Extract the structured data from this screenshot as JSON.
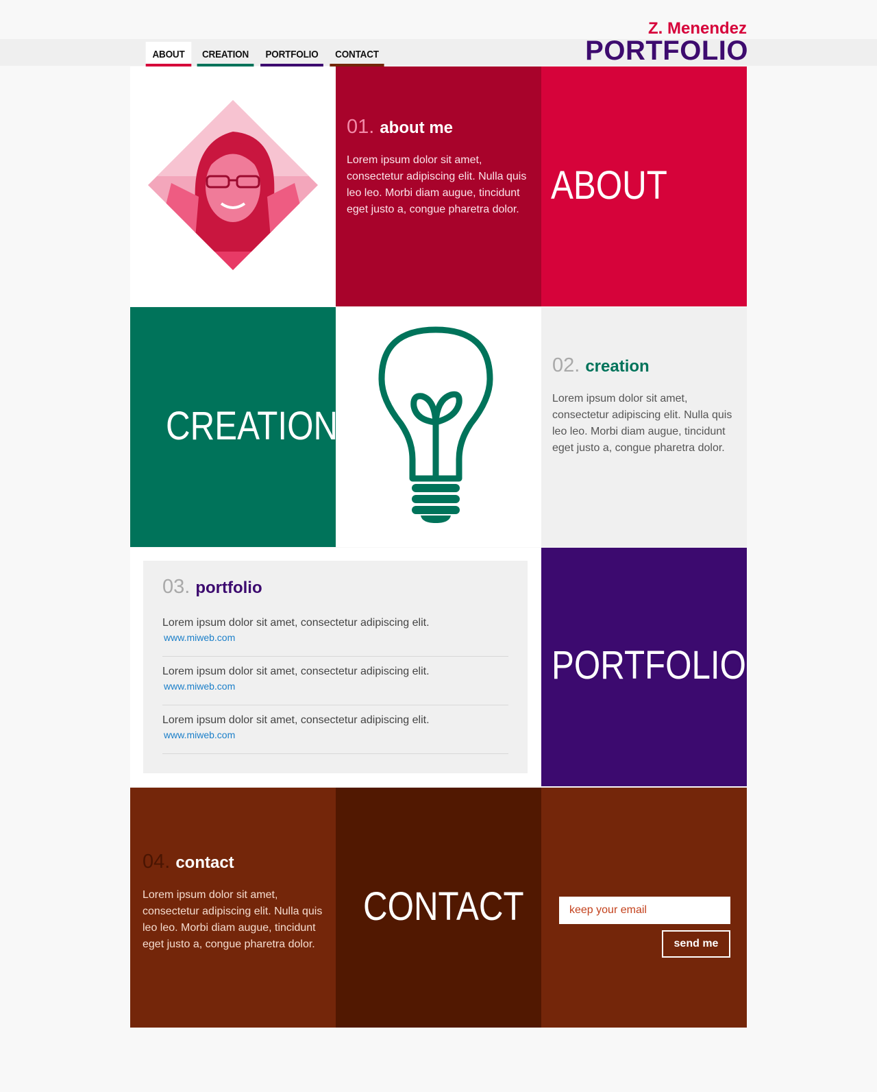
{
  "nav": {
    "items": [
      {
        "label": "ABOUT",
        "color": "#d6033a",
        "active": true
      },
      {
        "label": "CREATION",
        "color": "#00735a"
      },
      {
        "label": "PORTFOLIO",
        "color": "#3c0a6f"
      },
      {
        "label": "CONTACT",
        "color": "#74260a"
      }
    ]
  },
  "brand": {
    "name": "Z. Menendez",
    "title": "PORTFOLIO"
  },
  "about": {
    "num": "01.",
    "title": "about me",
    "body": "Lorem ipsum dolor sit amet, consectetur adipiscing elit. Nulla quis leo leo. Morbi diam augue, tincidunt eget justo a, congue pharetra dolor.",
    "big_word": "ABOUT",
    "photo_icon": "portrait-photo"
  },
  "creation": {
    "big_word": "CREATION",
    "icon": "lightbulb-icon",
    "num": "02.",
    "title": "creation",
    "body": "Lorem ipsum dolor sit amet, consectetur adipiscing elit. Nulla quis leo leo. Morbi diam augue, tincidunt eget justo a, congue pharetra dolor."
  },
  "portfolio": {
    "num": "03.",
    "title": "portfolio",
    "items": [
      {
        "text": "Lorem ipsum dolor sit amet, consectetur adipiscing elit.",
        "link": "www.miweb.com"
      },
      {
        "text": "Lorem ipsum dolor sit amet, consectetur adipiscing elit.",
        "link": "www.miweb.com"
      },
      {
        "text": "Lorem ipsum dolor sit amet, consectetur adipiscing elit.",
        "link": "www.miweb.com"
      }
    ],
    "big_word": "PORTFOLIO"
  },
  "contact": {
    "num": "04.",
    "title": "contact",
    "body": "Lorem ipsum dolor sit amet, consectetur adipiscing elit. Nulla quis leo leo. Morbi diam augue, tincidunt eget justo a, congue pharetra dolor.",
    "big_word": "CONTACT",
    "email_placeholder": "keep your email",
    "send_label": "send me"
  },
  "colors": {
    "about_red": "#d6033a",
    "about_dark": "#a8032b",
    "creation_green": "#00735a",
    "portfolio_purple": "#3c0a6f",
    "contact_brown": "#74260a",
    "contact_dark": "#511801"
  }
}
